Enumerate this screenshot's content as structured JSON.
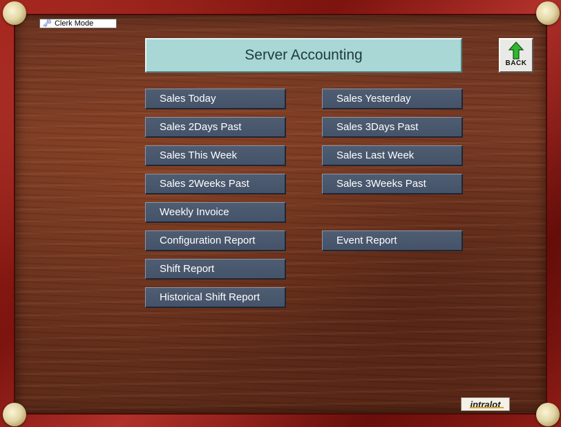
{
  "mode_badge": {
    "label": "Clerk Mode",
    "icon": "key-icon"
  },
  "header": {
    "title": "Server Accounting"
  },
  "back_button": {
    "label": "BACK",
    "icon": "up-arrow-icon",
    "icon_color": "#2fb82f"
  },
  "menu": {
    "left": [
      {
        "label": "Sales Today"
      },
      {
        "label": "Sales 2Days Past"
      },
      {
        "label": "Sales This Week"
      },
      {
        "label": "Sales 2Weeks Past"
      },
      {
        "label": "Weekly Invoice"
      },
      {
        "label": "Configuration Report"
      },
      {
        "label": "Shift Report"
      },
      {
        "label": "Historical Shift Report"
      }
    ],
    "right": [
      {
        "label": "Sales Yesterday"
      },
      {
        "label": "Sales 3Days Past"
      },
      {
        "label": "Sales Last Week"
      },
      {
        "label": "Sales 3Weeks Past"
      },
      {
        "label": "Event Report"
      }
    ]
  },
  "brand": {
    "logo_text": "intralot",
    "accent": "#d8a52a"
  },
  "colors": {
    "button_bg": "#4a586e",
    "title_bg": "#a8d7d6",
    "frame": "#8a1a14",
    "wood": "#6b3320"
  }
}
